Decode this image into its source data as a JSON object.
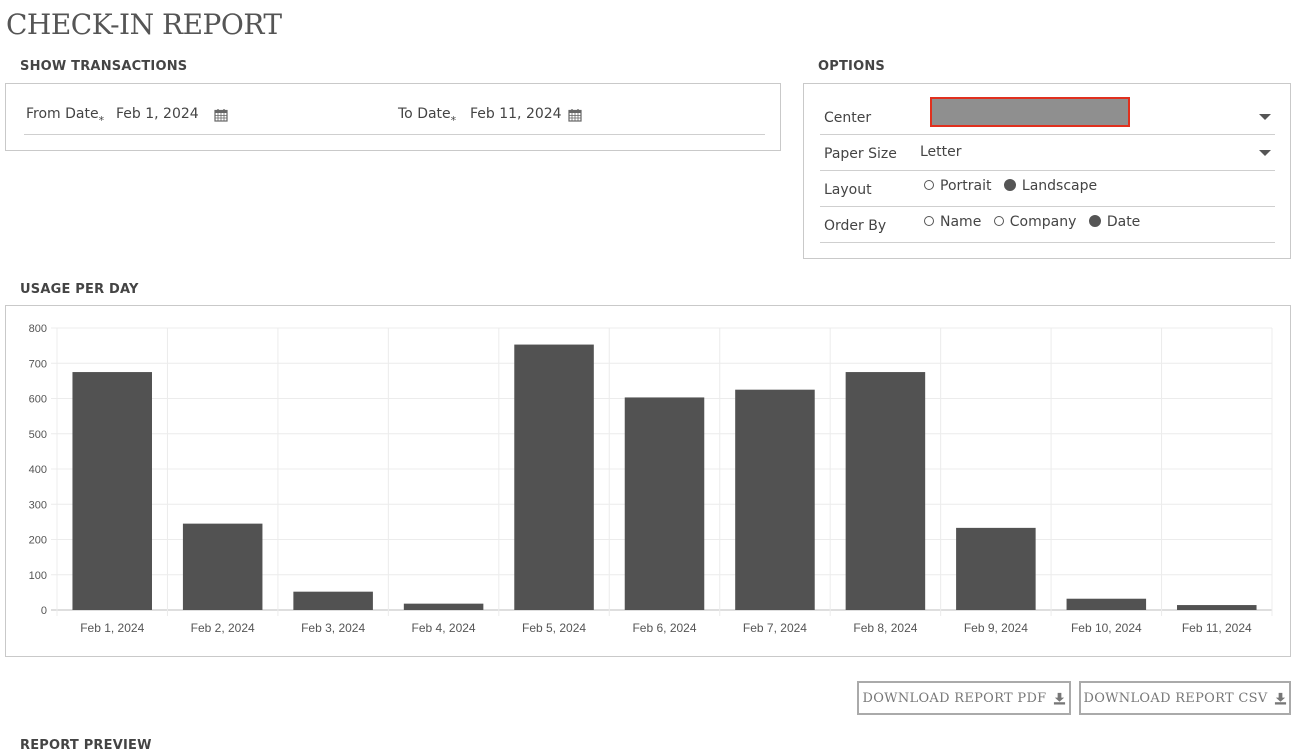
{
  "page": {
    "title": "CHECK-IN REPORT"
  },
  "transactions": {
    "heading": "SHOW TRANSACTIONS",
    "from_label": "From Date",
    "from_value": "Feb 1, 2024",
    "to_label": "To Date",
    "to_value": "Feb 11, 2024",
    "required_mark": "*",
    "calendar_icon": "calendar-icon"
  },
  "options": {
    "heading": "OPTIONS",
    "center_label": "Center",
    "center_value": "",
    "paper_label": "Paper Size",
    "paper_value": "Letter",
    "layout_label": "Layout",
    "layout_options": [
      "Portrait",
      "Landscape"
    ],
    "layout_selected": "Landscape",
    "order_label": "Order By",
    "order_options": [
      "Name",
      "Company",
      "Date"
    ],
    "order_selected": "Date"
  },
  "usage": {
    "heading": "USAGE PER DAY"
  },
  "chart_data": {
    "type": "bar",
    "categories": [
      "Feb 1, 2024",
      "Feb 2, 2024",
      "Feb 3, 2024",
      "Feb 4, 2024",
      "Feb 5, 2024",
      "Feb 6, 2024",
      "Feb 7, 2024",
      "Feb 8, 2024",
      "Feb 9, 2024",
      "Feb 10, 2024",
      "Feb 11, 2024"
    ],
    "values": [
      675,
      245,
      52,
      18,
      753,
      603,
      625,
      675,
      233,
      32,
      14
    ],
    "ylim": [
      0,
      800
    ],
    "yticks": [
      0,
      100,
      200,
      300,
      400,
      500,
      600,
      700,
      800
    ],
    "grid": true,
    "bar_color": "#525252",
    "title": "",
    "xlabel": "",
    "ylabel": ""
  },
  "actions": {
    "download_pdf": "DOWNLOAD REPORT PDF",
    "download_csv": "DOWNLOAD REPORT CSV",
    "download_icon": "download-icon"
  },
  "preview": {
    "heading": "REPORT PREVIEW"
  },
  "colors": {
    "accent_highlight": "#e0301e",
    "bar": "#525252",
    "border": "#c9c9c9"
  }
}
